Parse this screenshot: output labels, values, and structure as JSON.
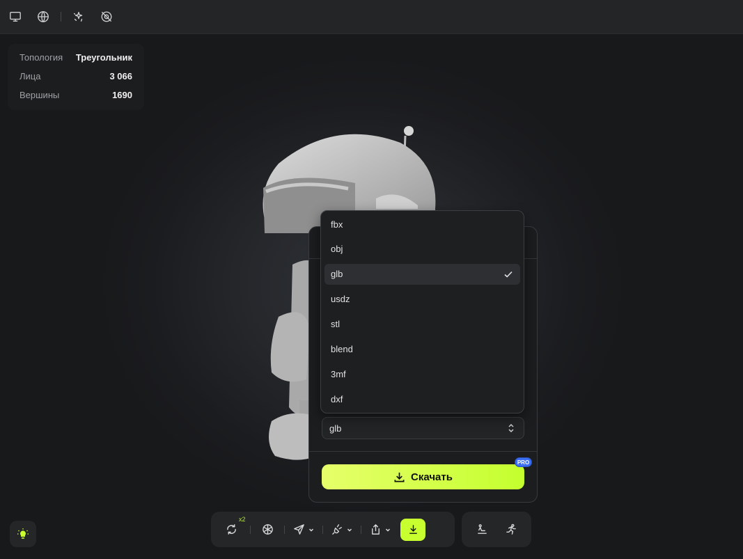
{
  "topbar": {
    "icons": [
      "monitor-icon",
      "globe-icon",
      "sparkle-icon",
      "no-texture-icon"
    ]
  },
  "stats": {
    "rows": [
      {
        "label": "Топология",
        "value": "Треугольник"
      },
      {
        "label": "Лица",
        "value": "3 066"
      },
      {
        "label": "Вершины",
        "value": "1690"
      }
    ]
  },
  "export": {
    "format_options": [
      "fbx",
      "obj",
      "glb",
      "usdz",
      "stl",
      "blend",
      "3mf",
      "dxf"
    ],
    "selected_format": "glb",
    "download_label": "Скачать",
    "pro_badge": "PRO"
  },
  "bottom_toolbar": {
    "x2_badge": "x2",
    "icons": [
      "refresh-icon",
      "mesh-icon",
      "send-icon",
      "plug-icon",
      "share-icon",
      "download-icon"
    ]
  },
  "bottom_toolbar2": {
    "icons": [
      "pose-icon",
      "run-icon"
    ]
  },
  "colors": {
    "accent": "#c8ff2e",
    "badge": "#3b6ef2"
  }
}
